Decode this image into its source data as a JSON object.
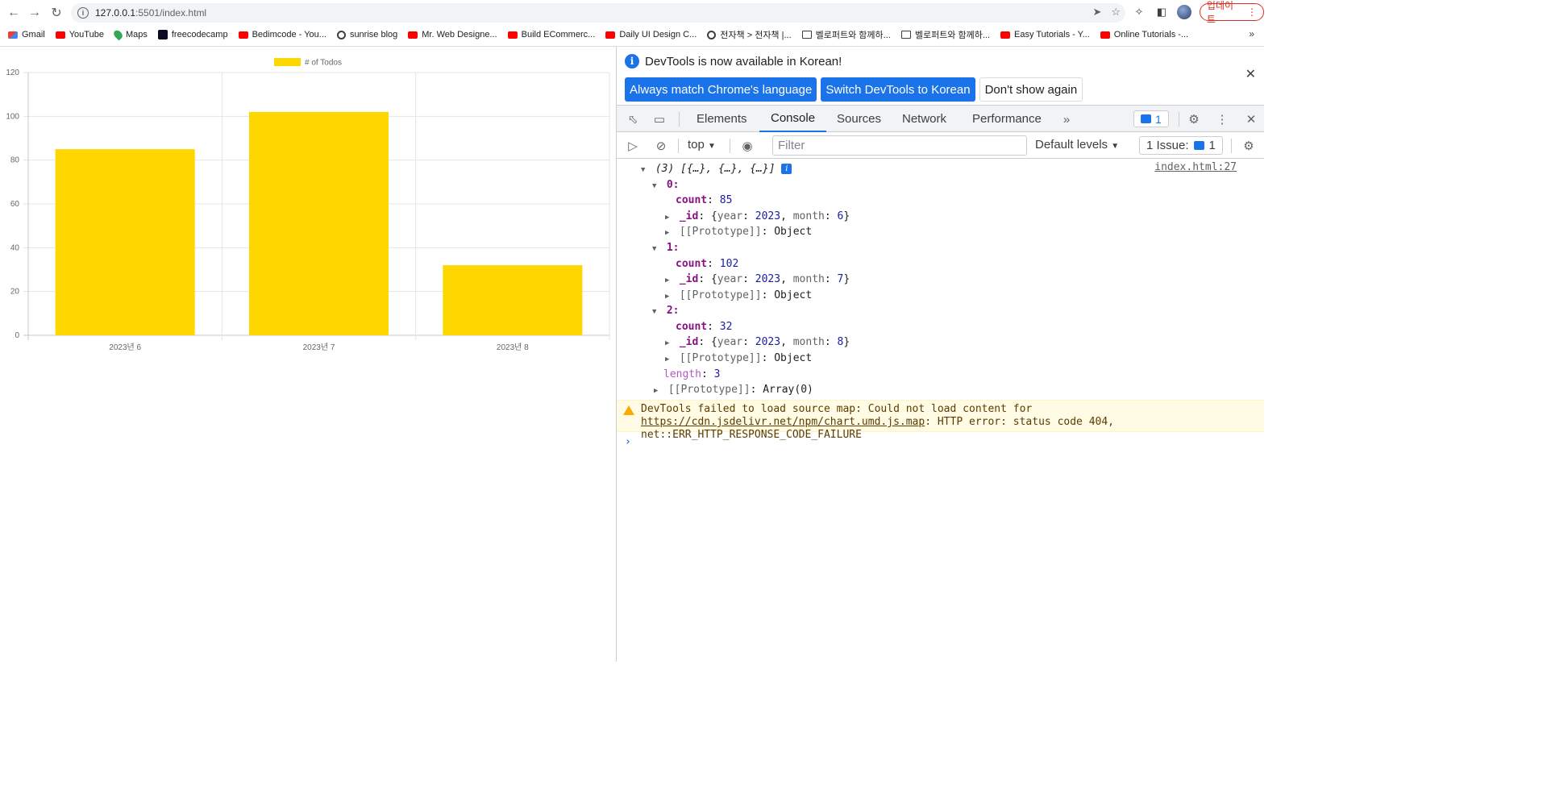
{
  "browser": {
    "url_host": "127.0.0.1",
    "url_path": ":5501/index.html",
    "update_label": "업데이트",
    "bookmarks": [
      {
        "label": "Gmail",
        "icon": "gmail-icon"
      },
      {
        "label": "YouTube",
        "icon": "youtube-icon"
      },
      {
        "label": "Maps",
        "icon": "maps-icon"
      },
      {
        "label": "freecodecamp",
        "icon": "freecodecamp-icon"
      },
      {
        "label": "Bedimcode - You...",
        "icon": "youtube-icon"
      },
      {
        "label": "sunrise blog",
        "icon": "globe-icon"
      },
      {
        "label": "Mr. Web Designe...",
        "icon": "youtube-icon"
      },
      {
        "label": "Build ECommerc...",
        "icon": "youtube-icon"
      },
      {
        "label": "Daily UI Design C...",
        "icon": "youtube-icon"
      },
      {
        "label": "전자책 > 전자책 |...",
        "icon": "globe-icon"
      },
      {
        "label": "벨로퍼트와 함께하...",
        "icon": "book-icon"
      },
      {
        "label": "벨로퍼트와 함께하...",
        "icon": "book-icon"
      },
      {
        "label": "Easy Tutorials - Y...",
        "icon": "youtube-icon"
      },
      {
        "label": "Online Tutorials -...",
        "icon": "youtube-icon"
      }
    ]
  },
  "chart_data": {
    "type": "bar",
    "categories": [
      "2023년 6",
      "2023년 7",
      "2023년 8"
    ],
    "series": [
      {
        "name": "# of Todos",
        "values": [
          85,
          102,
          32
        ],
        "color": "#FFD700"
      }
    ],
    "ylim": [
      0,
      120
    ],
    "yticks": [
      0,
      20,
      40,
      60,
      80,
      100,
      120
    ],
    "grid": true,
    "legend": "top-center"
  },
  "devtools": {
    "info_message": "DevTools is now available in Korean!",
    "btn_always_match": "Always match Chrome's language",
    "btn_switch_korean": "Switch DevTools to Korean",
    "btn_dont_show": "Don't show again",
    "tabs": [
      "Elements",
      "Console",
      "Sources",
      "Network",
      "Performance"
    ],
    "active_tab": "Console",
    "message_count": "1",
    "context": "top",
    "filter_placeholder": "Filter",
    "levels": "Default levels",
    "issues_label": "1 Issue:",
    "issues_count": "1",
    "console": {
      "array_summary": "(3) [{…}, {…}, {…}]",
      "source": "index.html:27",
      "entries": [
        {
          "index": "0:",
          "count": "85",
          "id_year": "2023",
          "id_month": "6"
        },
        {
          "index": "1:",
          "count": "102",
          "id_year": "2023",
          "id_month": "7"
        },
        {
          "index": "2:",
          "count": "32",
          "id_year": "2023",
          "id_month": "8"
        }
      ],
      "count_key": "count",
      "id_key": "_id",
      "proto_label": "[[Prototype]]",
      "proto_object": "Object",
      "length_key": "length",
      "length_value": "3",
      "array_proto": "Array(0)",
      "warning_prefix": "DevTools failed to load source map: Could not load content for ",
      "warning_link": "https://cdn.jsdelivr.net/npm/chart.umd.js.map",
      "warning_suffix": ": HTTP error: status code 404, net::ERR_HTTP_RESPONSE_CODE_FAILURE"
    }
  }
}
